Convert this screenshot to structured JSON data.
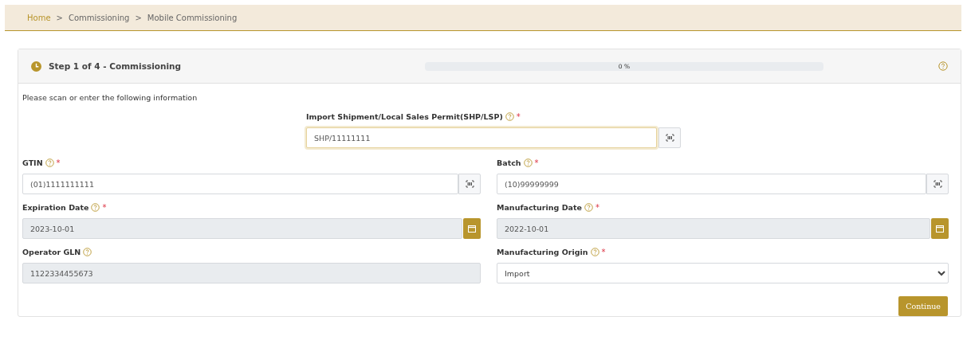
{
  "breadcrumb": [
    {
      "label": "Home",
      "link": true
    },
    {
      "label": ">",
      "link": false
    },
    {
      "label": "Commissioning",
      "link": false
    },
    {
      "label": ">",
      "link": false
    },
    {
      "label": "Mobile Commissioning",
      "link": false
    }
  ],
  "step": {
    "title": "Step 1 of 4 - Commissioning",
    "level": 0,
    "reading": "0 %"
  },
  "intro": "Please scan or enter the following information",
  "top_field": {
    "kind": "scan",
    "label": "Import Shipment/Local Sales Permit(SHP/LSP)",
    "required_mark": "*",
    "value": "SHP/11111111",
    "focused": true,
    "disabled": false
  },
  "fields": [
    {
      "kind": "scan",
      "label": "GTIN",
      "required_mark": "*",
      "value": "(01)1111111111",
      "disabled": false
    },
    {
      "kind": "scan",
      "label": "Batch",
      "required_mark": "*",
      "value": "(10)99999999",
      "disabled": false
    },
    {
      "kind": "date",
      "label": "Expiration Date",
      "required_mark": "*",
      "value": "2023-10-01",
      "disabled": true
    },
    {
      "kind": "date",
      "label": "Manufacturing Date",
      "required_mark": "*",
      "value": "2022-10-01",
      "disabled": true
    },
    {
      "kind": "text",
      "label": "Operator GLN",
      "value": "1122334455673",
      "disabled": true
    },
    {
      "kind": "select",
      "label": "Manufacturing Origin",
      "required_mark": "*",
      "value": "Import",
      "disabled": false
    }
  ],
  "continue_button": "Continue"
}
